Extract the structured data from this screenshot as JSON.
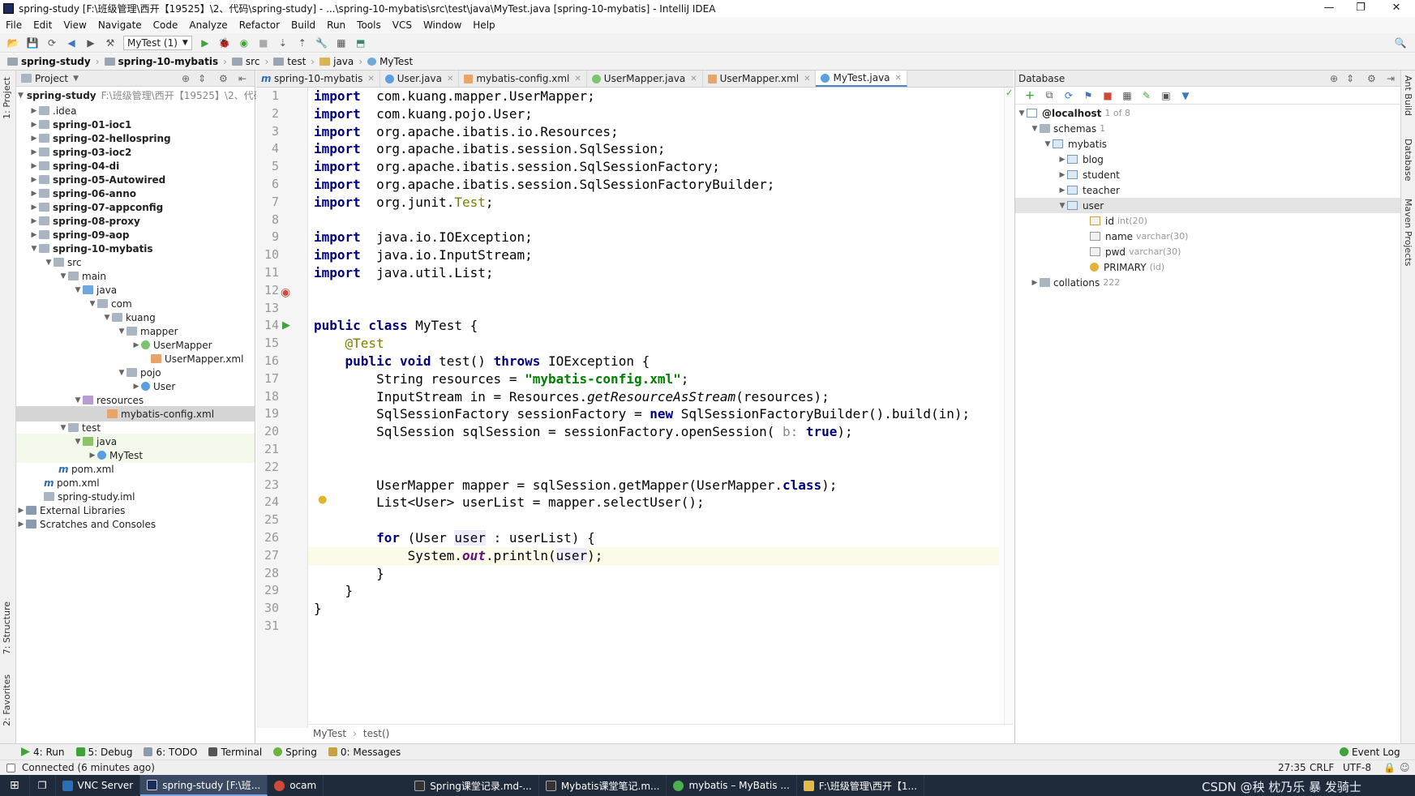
{
  "window": {
    "title": "spring-study [F:\\班级管理\\西开【19525】\\2、代码\\spring-study] - ...\\spring-10-mybatis\\src\\test\\java\\MyTest.java [spring-10-mybatis] - IntelliJ IDEA",
    "controls": [
      "—",
      "❐",
      "✕"
    ]
  },
  "menu": [
    "File",
    "Edit",
    "View",
    "Navigate",
    "Code",
    "Analyze",
    "Refactor",
    "Build",
    "Run",
    "Tools",
    "VCS",
    "Window",
    "Help"
  ],
  "toolbar": {
    "run_config": "MyTest (1)"
  },
  "breadcrumb": [
    "spring-study",
    "spring-10-mybatis",
    "src",
    "test",
    "java",
    "MyTest"
  ],
  "project": {
    "title": "Project",
    "rows": [
      {
        "label": "spring-study",
        "extra": "F:\\班级管理\\西开【19525】\\2、代码",
        "bold": true
      },
      {
        "label": ".idea"
      },
      {
        "label": "spring-01-ioc1",
        "bold": true
      },
      {
        "label": "spring-02-hellospring",
        "bold": true
      },
      {
        "label": "spring-03-ioc2",
        "bold": true
      },
      {
        "label": "spring-04-di",
        "bold": true
      },
      {
        "label": "spring-05-Autowired",
        "bold": true
      },
      {
        "label": "spring-06-anno",
        "bold": true
      },
      {
        "label": "spring-07-appconfig",
        "bold": true
      },
      {
        "label": "spring-08-proxy",
        "bold": true
      },
      {
        "label": "spring-09-aop",
        "bold": true
      },
      {
        "label": "spring-10-mybatis",
        "bold": true
      },
      {
        "label": "src"
      },
      {
        "label": "main"
      },
      {
        "label": "java"
      },
      {
        "label": "com"
      },
      {
        "label": "kuang"
      },
      {
        "label": "mapper"
      },
      {
        "label": "UserMapper"
      },
      {
        "label": "UserMapper.xml"
      },
      {
        "label": "pojo"
      },
      {
        "label": "User"
      },
      {
        "label": "resources"
      },
      {
        "label": "mybatis-config.xml"
      },
      {
        "label": "test"
      },
      {
        "label": "java"
      },
      {
        "label": "MyTest"
      },
      {
        "label": "pom.xml"
      },
      {
        "label": "pom.xml"
      },
      {
        "label": "spring-study.iml"
      },
      {
        "label": "External Libraries"
      },
      {
        "label": "Scratches and Consoles"
      }
    ]
  },
  "editor_tabs": [
    "spring-10-mybatis",
    "User.java",
    "mybatis-config.xml",
    "UserMapper.java",
    "UserMapper.xml",
    "MyTest.java"
  ],
  "code_lines": [
    [
      [
        "kw",
        "import"
      ],
      [
        "",
        "  com.kuang.mapper.UserMapper;"
      ]
    ],
    [
      [
        "kw",
        "import"
      ],
      [
        "",
        "  com.kuang.pojo.User;"
      ]
    ],
    [
      [
        "kw",
        "import"
      ],
      [
        "",
        "  org.apache.ibatis.io.Resources;"
      ]
    ],
    [
      [
        "kw",
        "import"
      ],
      [
        "",
        "  org.apache.ibatis.session.SqlSession;"
      ]
    ],
    [
      [
        "kw",
        "import"
      ],
      [
        "",
        "  org.apache.ibatis.session.SqlSessionFactory;"
      ]
    ],
    [
      [
        "kw",
        "import"
      ],
      [
        "",
        "  org.apache.ibatis.session.SqlSessionFactoryBuilder;"
      ]
    ],
    [
      [
        "kw",
        "import"
      ],
      [
        "",
        "  org.junit."
      ],
      [
        "an",
        "Test"
      ],
      [
        "",
        ";"
      ]
    ],
    [],
    [
      [
        "kw",
        "import"
      ],
      [
        "",
        "  java.io.IOException;"
      ]
    ],
    [
      [
        "kw",
        "import"
      ],
      [
        "",
        "  java.io.InputStream;"
      ]
    ],
    [
      [
        "kw",
        "import"
      ],
      [
        "",
        "  java.util.List;"
      ]
    ],
    [],
    [],
    [
      [
        "kw",
        "public class"
      ],
      [
        "",
        " MyTest {"
      ]
    ],
    [
      [
        "",
        "    "
      ],
      [
        "an",
        "@Test"
      ]
    ],
    [
      [
        "",
        "    "
      ],
      [
        "kw",
        "public void"
      ],
      [
        "",
        " test() "
      ],
      [
        "kw",
        "throws"
      ],
      [
        "",
        " IOException {"
      ]
    ],
    [
      [
        "",
        "        String resources = "
      ],
      [
        "str",
        "\"mybatis-config.xml\""
      ],
      [
        "",
        ";"
      ]
    ],
    [
      [
        "",
        "        InputStream in = Resources."
      ],
      [
        "it",
        "getResourceAsStream"
      ],
      [
        "",
        "(resources);"
      ]
    ],
    [
      [
        "",
        "        SqlSessionFactory sessionFactory = "
      ],
      [
        "kw",
        "new"
      ],
      [
        "",
        " SqlSessionFactoryBuilder().build(in);"
      ]
    ],
    [
      [
        "",
        "        SqlSession sqlSession = sessionFactory.openSession( "
      ],
      [
        "hint",
        "b:"
      ],
      [
        "",
        " "
      ],
      [
        "kw",
        "true"
      ],
      [
        "",
        ");"
      ]
    ],
    [],
    [],
    [
      [
        "",
        "        UserMapper mapper = sqlSession.getMapper(UserMapper."
      ],
      [
        "kw",
        "class"
      ],
      [
        "",
        ");"
      ]
    ],
    [
      [
        "",
        "        List<User> userList = mapper.selectUser();"
      ]
    ],
    [],
    [
      [
        "",
        "        "
      ],
      [
        "kw",
        "for"
      ],
      [
        "",
        " (User "
      ],
      [
        "var",
        "user"
      ],
      [
        "",
        " : userList) {"
      ]
    ],
    [
      [
        "",
        "            System."
      ],
      [
        "fld",
        "out"
      ],
      [
        "",
        ".println("
      ],
      [
        "var",
        "user"
      ],
      [
        "",
        ");"
      ]
    ],
    [
      [
        "",
        "        }"
      ]
    ],
    [
      [
        "",
        "    }"
      ]
    ],
    [
      [
        "",
        "}"
      ]
    ],
    []
  ],
  "editor_breadcrumb": [
    "MyTest",
    "test()"
  ],
  "database": {
    "title": "Database",
    "rows": [
      {
        "label": "@localhost",
        "extra": "1 of 8"
      },
      {
        "label": "schemas",
        "extra": "1"
      },
      {
        "label": "mybatis",
        "extra": ""
      },
      {
        "label": "blog",
        "extra": ""
      },
      {
        "label": "student",
        "extra": ""
      },
      {
        "label": "teacher",
        "extra": ""
      },
      {
        "label": "user",
        "extra": ""
      },
      {
        "label": "id",
        "extra": "int(20)"
      },
      {
        "label": "name",
        "extra": "varchar(30)"
      },
      {
        "label": "pwd",
        "extra": "varchar(30)"
      },
      {
        "label": "PRIMARY",
        "extra": "(id)"
      },
      {
        "label": "collations",
        "extra": "222"
      }
    ]
  },
  "left_tool_windows": [
    "1: Project",
    "7: Structure",
    "2: Favorites"
  ],
  "right_tool_windows": [
    "Ant Build",
    "Database",
    "Maven Projects"
  ],
  "bottom_tabs": [
    "4: Run",
    "5: Debug",
    "6: TODO",
    "Terminal",
    "Spring",
    "0: Messages"
  ],
  "event_log": "Event Log",
  "status": {
    "message": "Connected (6 minutes ago)",
    "position": "27:35",
    "line_sep": "CRLF",
    "encoding": "UTF-8"
  },
  "taskbar": [
    "VNC Server",
    "spring-study [F:\\班...",
    "ocam",
    "Spring课堂记录.md-...",
    "Mybatis课堂笔记.m...",
    "mybatis – MyBatis ...",
    "F:\\班级管理\\西开【1..."
  ],
  "watermark": "CSDN @秧 枕乃乐 暴 发骑士"
}
